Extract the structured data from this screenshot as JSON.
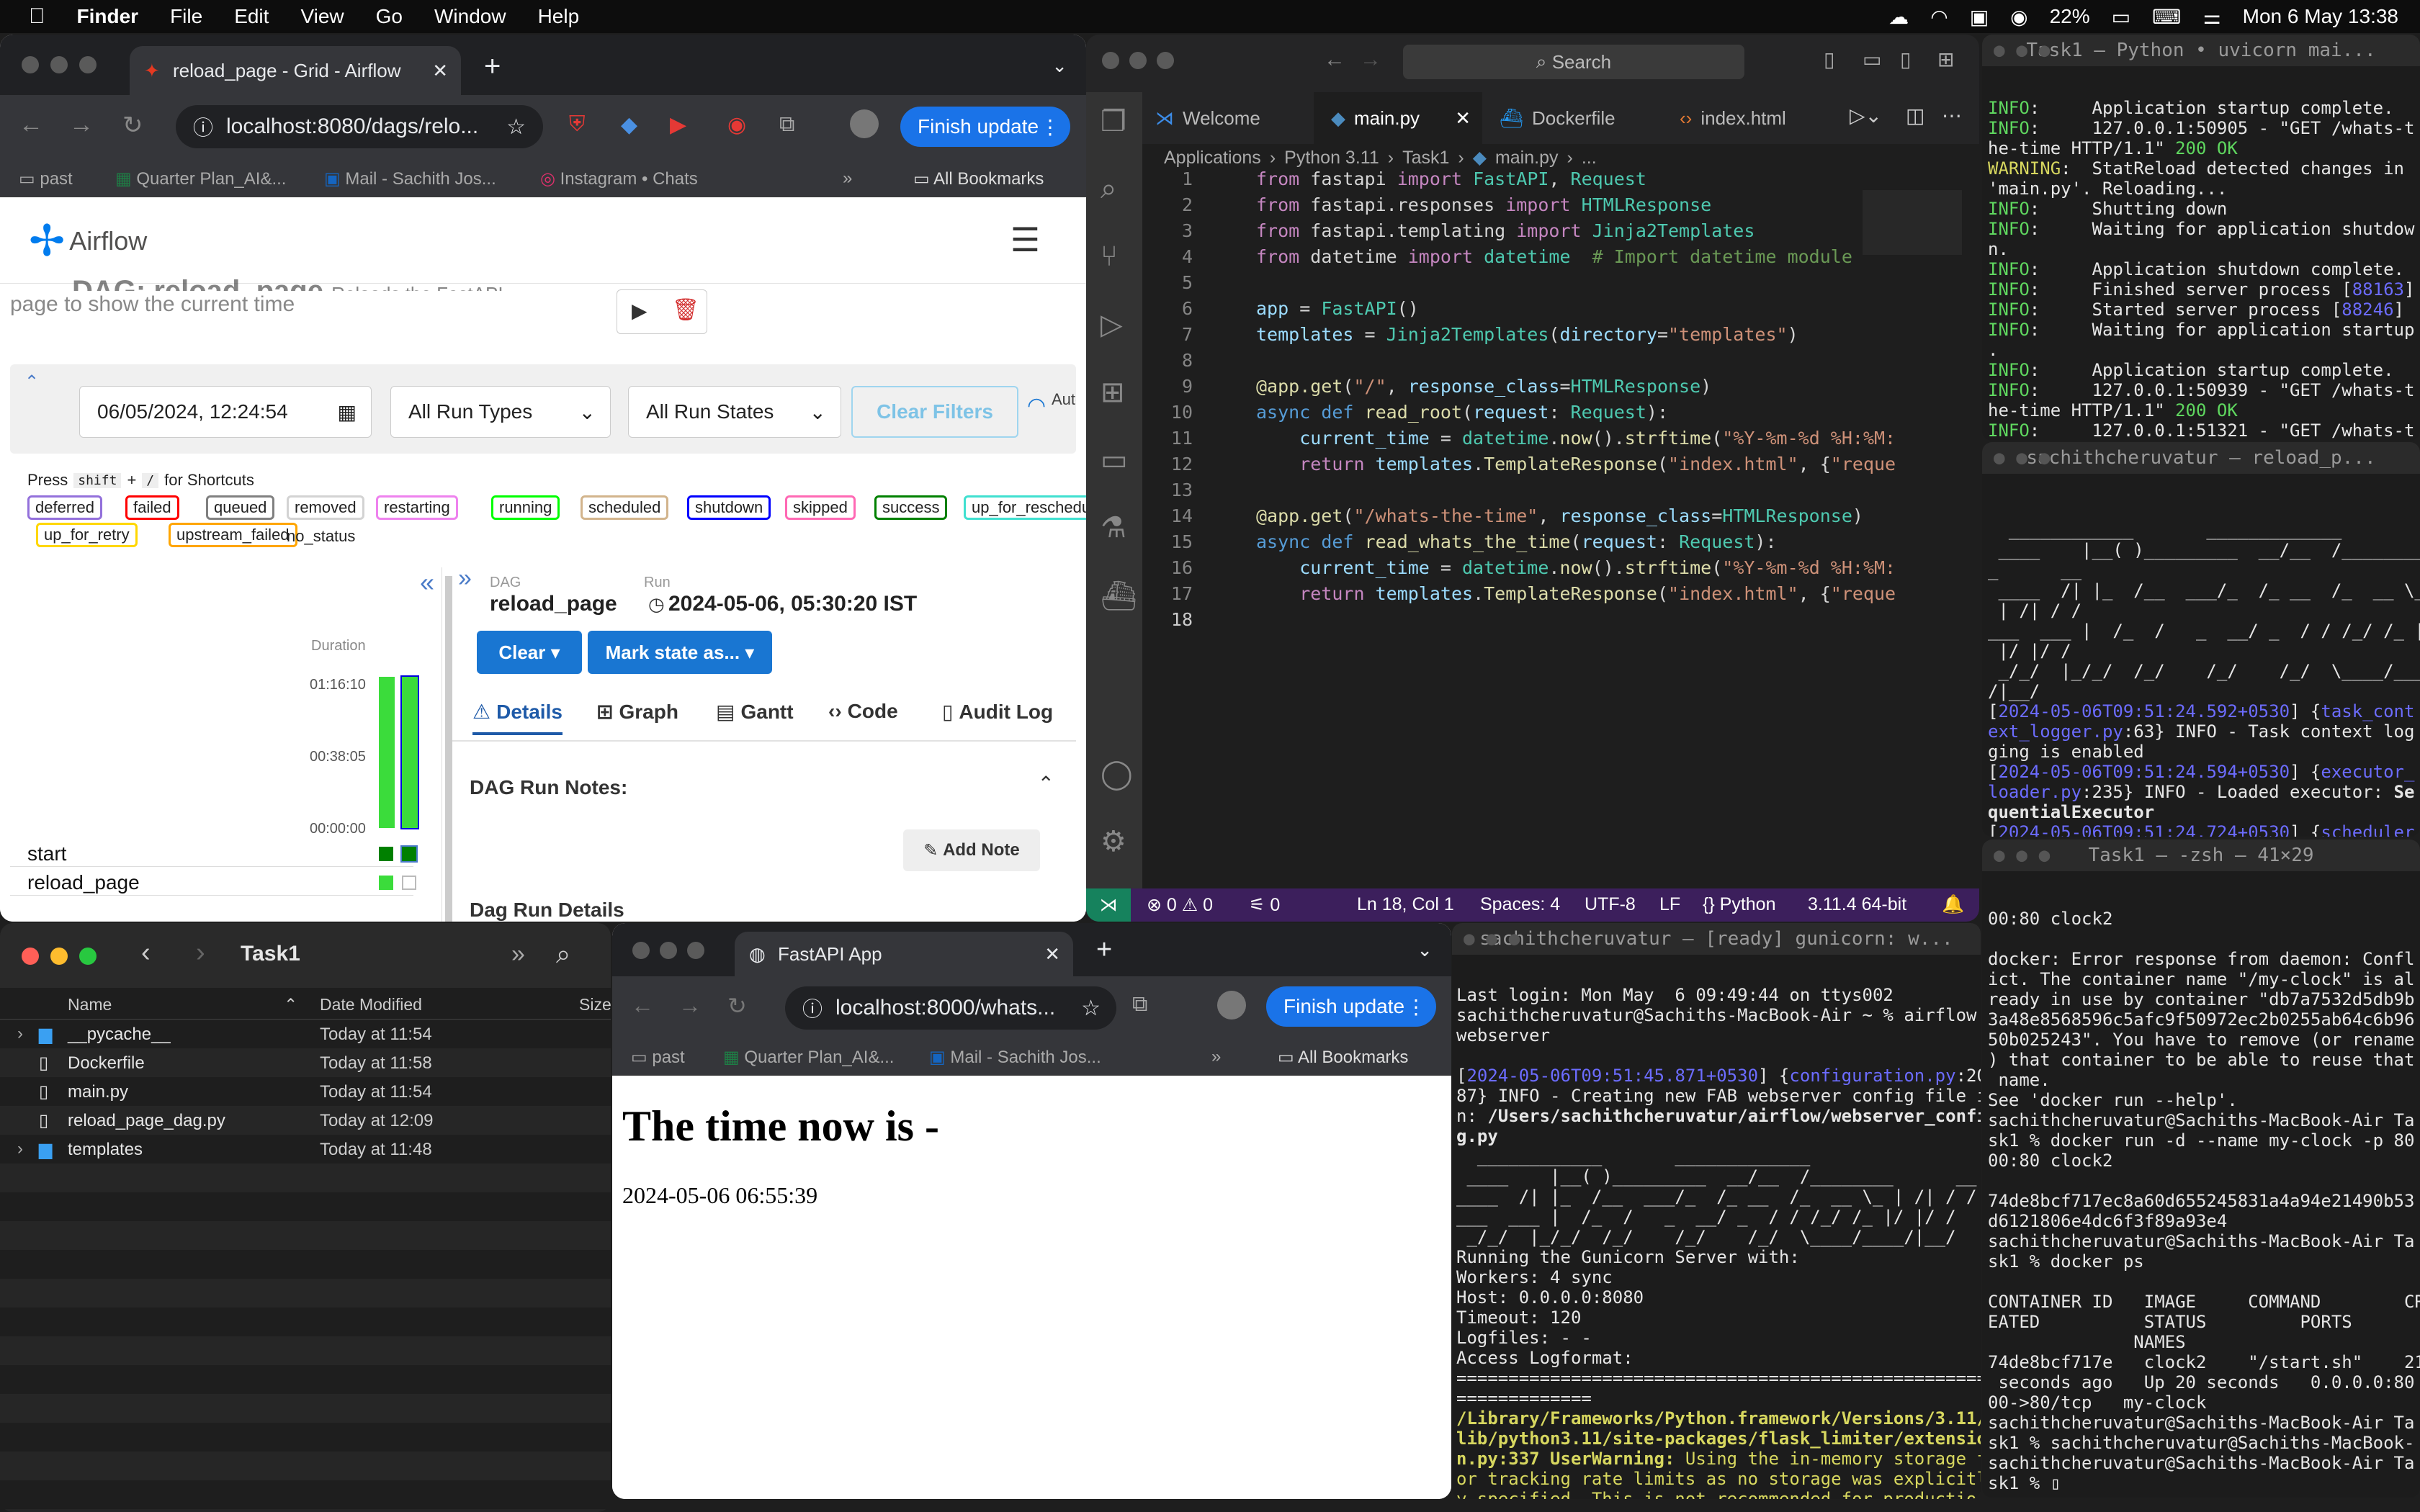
{
  "menubar": {
    "app": "Finder",
    "items": [
      "File",
      "Edit",
      "View",
      "Go",
      "Window",
      "Help"
    ],
    "battery": "22%",
    "clock": "Mon 6 May  13:38"
  },
  "airflow_browser": {
    "tab_title": "reload_page - Grid - Airflow",
    "url": "localhost:8080/dags/relo...",
    "finish_update": "Finish update",
    "bookmarks": [
      "past",
      "Quarter Plan_AI&...",
      "Mail - Sachith Jos...",
      "Instagram • Chats"
    ],
    "all_bookmarks": "All Bookmarks",
    "brand": "Airflow",
    "dag_title": "DAG: reload_page",
    "dag_title_partial": "Reloads the FastAPI",
    "description": "page to show the current time",
    "date_filter": "06/05/2024, 12:24:54",
    "run_types": "All Run Types",
    "run_states": "All Run States",
    "clear_filters": "Clear Filters",
    "auto_refresh": "Auto refresh",
    "shortcut_pre": "Press",
    "shortcut_key1": "shift",
    "shortcut_plus": "+",
    "shortcut_key2": "/",
    "shortcut_post": "for Shortcuts",
    "states": [
      {
        "label": "deferred",
        "color": "#9370db"
      },
      {
        "label": "failed",
        "color": "#ff0000"
      },
      {
        "label": "queued",
        "color": "#808080"
      },
      {
        "label": "removed",
        "color": "#d3d3d3"
      },
      {
        "label": "restarting",
        "color": "#ee82ee"
      },
      {
        "label": "running",
        "color": "#00ff00"
      },
      {
        "label": "scheduled",
        "color": "#d2b48c"
      },
      {
        "label": "shutdown",
        "color": "#0000ff"
      },
      {
        "label": "skipped",
        "color": "#ff69b4"
      },
      {
        "label": "success",
        "color": "#008000"
      },
      {
        "label": "up_for_reschedule",
        "color": "#40e0d0"
      }
    ],
    "states2": [
      {
        "label": "up_for_retry",
        "color": "#ffd700"
      },
      {
        "label": "upstream_failed",
        "color": "#ffa500"
      }
    ],
    "no_status": "no_status",
    "duration_label": "Duration",
    "durations": [
      "01:16:10",
      "00:38:05",
      "00:00:00"
    ],
    "tasks": [
      "start",
      "reload_page"
    ],
    "dag_label": "DAG",
    "dag_name": "reload_page",
    "run_label": "Run",
    "run_value": "2024-05-06, 05:30:20 IST",
    "clear_btn": "Clear",
    "mark_state_btn": "Mark state as...",
    "tabs": [
      "Details",
      "Graph",
      "Gantt",
      "Code",
      "Audit Log"
    ],
    "notes_title": "DAG Run Notes:",
    "add_note": "Add Note",
    "run_details": "Dag Run Details"
  },
  "vscode": {
    "search": "Search",
    "tabs": [
      "Welcome",
      "main.py",
      "Dockerfile",
      "index.html"
    ],
    "breadcrumb": [
      "Applications",
      "Python 3.11",
      "Task1",
      "main.py",
      "..."
    ],
    "status": {
      "errors": "0",
      "warnings": "0",
      "ports": "0",
      "position": "Ln 18, Col 1",
      "spaces": "Spaces: 4",
      "encoding": "UTF-8",
      "eol": "LF",
      "lang": "Python",
      "interp": "3.11.4 64-bit"
    }
  },
  "term1": {
    "title": "Task1 — Python • uvicorn mai..."
  },
  "term2": {
    "title": "sachithcheruvatur — reload_p..."
  },
  "term3": {
    "title": "Task1 — -zsh — 41×29"
  },
  "term4": {
    "title": "sachithcheruvatur — [ready] gunicorn: w..."
  },
  "finder": {
    "title": "Task1",
    "columns": [
      "Name",
      "Date Modified",
      "Size"
    ],
    "rows": [
      {
        "name": "__pycache__",
        "date": "Today at 11:54",
        "type": "folder"
      },
      {
        "name": "Dockerfile",
        "date": "Today at 11:58",
        "type": "file"
      },
      {
        "name": "main.py",
        "date": "Today at 11:54",
        "type": "file"
      },
      {
        "name": "reload_page_dag.py",
        "date": "Today at 12:09",
        "type": "file"
      },
      {
        "name": "templates",
        "date": "Today at 11:48",
        "type": "folder"
      }
    ]
  },
  "fastapi_browser": {
    "tab_title": "FastAPI App",
    "url": "localhost:8000/whats...",
    "finish_update": "Finish update",
    "bookmarks": [
      "past",
      "Quarter Plan_AI&...",
      "Mail - Sachith Jos..."
    ],
    "all_bookmarks": "All Bookmarks",
    "heading": "The time now is -",
    "time": "2024-05-06 06:55:39"
  }
}
